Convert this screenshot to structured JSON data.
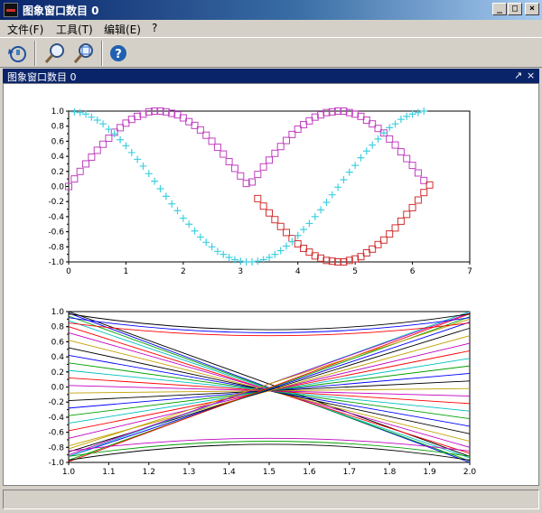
{
  "window": {
    "title": "图象窗口数目 0",
    "minimize_glyph": "_",
    "maximize_glyph": "□",
    "close_glyph": "×"
  },
  "menubar": {
    "items": [
      {
        "label": "文件(F)"
      },
      {
        "label": "工具(T)"
      },
      {
        "label": "编辑(E)"
      },
      {
        "label": "?"
      }
    ]
  },
  "toolbar": {
    "buttons": [
      {
        "icon": "rotate-icon"
      },
      {
        "icon": "zoom-icon"
      },
      {
        "icon": "zoom-reset-icon"
      },
      {
        "icon": "help-icon"
      }
    ]
  },
  "dock": {
    "title": "图象窗口数目 0",
    "undock_glyph": "↗",
    "close_glyph": "×"
  },
  "colors": {
    "sin_series": "#c040c0",
    "sin_highlight": "#d03030",
    "cos_series": "#40d0e0",
    "accent": "#0a246a"
  },
  "chart_data": [
    {
      "type": "scatter",
      "title": "",
      "xlabel": "",
      "ylabel": "",
      "xlim": [
        0,
        7
      ],
      "ylim": [
        -1.0,
        1.0
      ],
      "x_ticks": [
        "0",
        "1",
        "2",
        "3",
        "4",
        "5",
        "6",
        "7"
      ],
      "y_ticks": [
        "1.0",
        "0.8",
        "0.6",
        "0.4",
        "0.2",
        "0.0",
        "-0.2",
        "-0.4",
        "-0.6",
        "-0.8",
        "-1.0"
      ],
      "grid": false,
      "series": [
        {
          "marker": "square",
          "x": [
            0,
            0.1,
            0.2,
            0.3,
            0.4,
            0.5,
            0.6,
            0.7,
            0.8,
            0.9,
            1.0,
            1.1,
            1.2,
            1.3,
            1.4,
            1.5,
            1.6,
            1.7,
            1.8,
            1.9,
            2.0,
            2.1,
            2.2,
            2.3,
            2.4,
            2.5,
            2.6,
            2.7,
            2.8,
            2.9,
            3.0,
            3.1,
            3.2,
            3.3,
            3.4,
            3.5,
            3.6,
            3.7,
            3.8,
            3.9,
            4.0,
            4.1,
            4.2,
            4.3,
            4.4,
            4.5,
            4.6,
            4.7,
            4.8,
            4.9,
            5.0,
            5.1,
            5.2,
            5.3,
            5.4,
            5.5,
            5.6,
            5.7,
            5.8,
            5.9,
            6.0,
            6.1,
            6.2
          ],
          "y": [
            0,
            0.1,
            0.2,
            0.3,
            0.39,
            0.48,
            0.56,
            0.64,
            0.72,
            0.78,
            0.84,
            0.89,
            0.93,
            0.96,
            0.99,
            1.0,
            1.0,
            0.99,
            0.97,
            0.95,
            0.91,
            0.86,
            0.81,
            0.75,
            0.68,
            0.6,
            0.52,
            0.43,
            0.33,
            0.24,
            0.14,
            0.04,
            0.06,
            0.16,
            0.26,
            0.35,
            0.44,
            0.53,
            0.61,
            0.69,
            0.76,
            0.82,
            0.87,
            0.92,
            0.95,
            0.98,
            0.99,
            1.0,
            1.0,
            0.98,
            0.96,
            0.93,
            0.88,
            0.83,
            0.77,
            0.71,
            0.63,
            0.55,
            0.46,
            0.37,
            0.28,
            0.18,
            0.08
          ]
        },
        {
          "marker": "square",
          "x": [
            3.3,
            3.4,
            3.5,
            3.6,
            3.7,
            3.8,
            3.9,
            4.0,
            4.1,
            4.2,
            4.3,
            4.4,
            4.5,
            4.6,
            4.7,
            4.8,
            4.9,
            5.0,
            5.1,
            5.2,
            5.3,
            5.4,
            5.5,
            5.6,
            5.7,
            5.8,
            5.9,
            6.0,
            6.1,
            6.2,
            6.3
          ],
          "y": [
            -0.16,
            -0.26,
            -0.35,
            -0.44,
            -0.53,
            -0.61,
            -0.69,
            -0.76,
            -0.82,
            -0.87,
            -0.92,
            -0.95,
            -0.98,
            -0.99,
            -1.0,
            -1.0,
            -0.98,
            -0.96,
            -0.93,
            -0.88,
            -0.83,
            -0.77,
            -0.71,
            -0.63,
            -0.55,
            -0.46,
            -0.37,
            -0.28,
            -0.18,
            -0.08,
            0.02
          ]
        },
        {
          "marker": "plus",
          "x": [
            0.1,
            0.2,
            0.3,
            0.4,
            0.5,
            0.6,
            0.7,
            0.8,
            0.9,
            1.0,
            1.1,
            1.2,
            1.3,
            1.4,
            1.5,
            1.6,
            1.7,
            1.8,
            1.9,
            2.0,
            2.1,
            2.2,
            2.3,
            2.4,
            2.5,
            2.6,
            2.7,
            2.8,
            2.9,
            3.0,
            3.1,
            3.2,
            3.3,
            3.4,
            3.5,
            3.6,
            3.7,
            3.8,
            3.9,
            4.0,
            4.1,
            4.2,
            4.3,
            4.4,
            4.5,
            4.6,
            4.7,
            4.8,
            4.9,
            5.0,
            5.1,
            5.2,
            5.3,
            5.4,
            5.5,
            5.6,
            5.7,
            5.8,
            5.9,
            6.0,
            6.1,
            6.2
          ],
          "y": [
            0.99,
            0.98,
            0.96,
            0.92,
            0.88,
            0.83,
            0.76,
            0.7,
            0.62,
            0.54,
            0.45,
            0.36,
            0.27,
            0.17,
            0.07,
            -0.03,
            -0.13,
            -0.23,
            -0.32,
            -0.42,
            -0.5,
            -0.59,
            -0.67,
            -0.74,
            -0.8,
            -0.86,
            -0.9,
            -0.94,
            -0.97,
            -0.99,
            -1.0,
            -1.0,
            -0.99,
            -0.97,
            -0.94,
            -0.9,
            -0.85,
            -0.79,
            -0.73,
            -0.65,
            -0.57,
            -0.49,
            -0.4,
            -0.31,
            -0.21,
            -0.11,
            -0.01,
            0.09,
            0.19,
            0.28,
            0.38,
            0.47,
            0.55,
            0.63,
            0.71,
            0.78,
            0.83,
            0.89,
            0.93,
            0.96,
            0.98,
            1.0
          ]
        }
      ]
    },
    {
      "type": "line",
      "title": "",
      "xlabel": "",
      "ylabel": "",
      "xlim": [
        1.0,
        2.0
      ],
      "ylim": [
        -1.0,
        1.0
      ],
      "x_ticks": [
        "1.0",
        "1.1",
        "1.2",
        "1.3",
        "1.4",
        "1.5",
        "1.6",
        "1.7",
        "1.8",
        "1.9",
        "2.0"
      ],
      "y_ticks": [
        "1.0",
        "0.8",
        "0.6",
        "0.4",
        "0.2",
        "0.0",
        "-0.2",
        "-0.4",
        "-0.6",
        "-0.8",
        "-1.0"
      ],
      "grid": false,
      "x": [
        1.0,
        2.0
      ],
      "series": [
        {
          "color": "#000000",
          "y": [
            1.0,
            -0.92
          ]
        },
        {
          "color": "#0000ff",
          "y": [
            0.98,
            -1.0
          ]
        },
        {
          "color": "#00a000",
          "y": [
            0.94,
            -0.98
          ]
        },
        {
          "color": "#00c0c0",
          "y": [
            0.88,
            -0.94
          ]
        },
        {
          "color": "#ff0000",
          "y": [
            0.8,
            -0.88
          ]
        },
        {
          "color": "#c000c0",
          "y": [
            0.72,
            -0.8
          ]
        },
        {
          "color": "#c0a000",
          "y": [
            0.62,
            -0.72
          ]
        },
        {
          "color": "#000000",
          "y": [
            0.52,
            -0.62
          ]
        },
        {
          "color": "#0000ff",
          "y": [
            0.42,
            -0.52
          ]
        },
        {
          "color": "#00a000",
          "y": [
            0.32,
            -0.42
          ]
        },
        {
          "color": "#00c0c0",
          "y": [
            0.22,
            -0.32
          ]
        },
        {
          "color": "#ff0000",
          "y": [
            0.12,
            -0.22
          ]
        },
        {
          "color": "#c000c0",
          "y": [
            0.02,
            -0.12
          ]
        },
        {
          "color": "#c0a000",
          "y": [
            -0.08,
            -0.02
          ]
        },
        {
          "color": "#000000",
          "y": [
            -0.18,
            0.08
          ]
        },
        {
          "color": "#0000ff",
          "y": [
            -0.28,
            0.18
          ]
        },
        {
          "color": "#00a000",
          "y": [
            -0.38,
            0.28
          ]
        },
        {
          "color": "#00c0c0",
          "y": [
            -0.48,
            0.38
          ]
        },
        {
          "color": "#ff0000",
          "y": [
            -0.58,
            0.48
          ]
        },
        {
          "color": "#c000c0",
          "y": [
            -0.68,
            0.58
          ]
        },
        {
          "color": "#c0a000",
          "y": [
            -0.78,
            0.68
          ]
        },
        {
          "color": "#000000",
          "y": [
            -0.86,
            0.78
          ]
        },
        {
          "color": "#0000ff",
          "y": [
            -0.92,
            0.86
          ]
        },
        {
          "color": "#00a000",
          "y": [
            -0.97,
            0.93
          ]
        },
        {
          "color": "#00c0c0",
          "y": [
            -0.92,
            1.0
          ]
        },
        {
          "color": "#ff0000",
          "y": [
            -0.99,
            0.97
          ]
        },
        {
          "color": "#c000c0",
          "y": [
            -0.9,
            0.98
          ]
        },
        {
          "color": "#c0a000",
          "y": [
            -0.82,
            0.9
          ]
        }
      ],
      "curves": [
        {
          "color": "#000000",
          "y_end": 0.97,
          "y_mid": 0.76
        },
        {
          "color": "#0000ff",
          "y_end": 0.92,
          "y_mid": 0.72
        },
        {
          "color": "#ff0000",
          "y_end": 0.85,
          "y_mid": 0.68
        },
        {
          "color": "#000000",
          "y_end": -0.97,
          "y_mid": -0.76
        },
        {
          "color": "#00a000",
          "y_end": -0.92,
          "y_mid": -0.72
        },
        {
          "color": "#c000c0",
          "y_end": -0.85,
          "y_mid": -0.68
        }
      ]
    }
  ]
}
